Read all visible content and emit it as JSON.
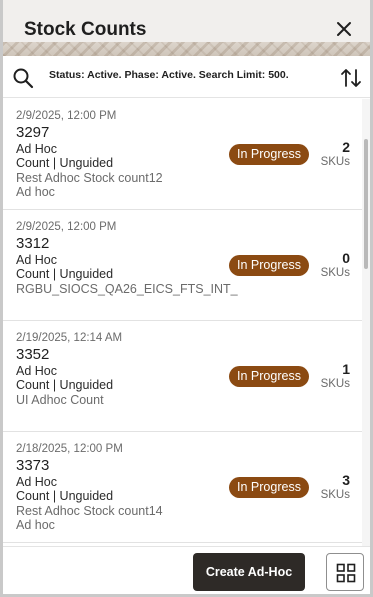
{
  "header": {
    "title": "Stock Counts",
    "close_icon": "close-icon"
  },
  "filter": {
    "search_icon": "search-icon",
    "summary": "Status: Active. Phase: Active. Search Limit: 500.",
    "sort_icon": "sort-icon"
  },
  "counts": [
    {
      "date": "2/9/2025, 12:00 PM",
      "id": "3297",
      "type": "Ad Hoc",
      "mode": "Count | Unguided",
      "description": "Rest Adhoc Stock count12",
      "subtype": "Ad hoc",
      "status": "In Progress",
      "sku_count": "2",
      "sku_label": "SKUs"
    },
    {
      "date": "2/9/2025, 12:00 PM",
      "id": "3312",
      "type": "Ad Hoc",
      "mode": "Count | Unguided",
      "description": "RGBU_SIOCS_QA26_EICS_FTS_INT_",
      "subtype": "",
      "status": "In Progress",
      "sku_count": "0",
      "sku_label": "SKUs"
    },
    {
      "date": "2/19/2025, 12:14 AM",
      "id": "3352",
      "type": "Ad Hoc",
      "mode": "Count | Unguided",
      "description": "UI Adhoc Count",
      "subtype": "",
      "status": "In Progress",
      "sku_count": "1",
      "sku_label": "SKUs"
    },
    {
      "date": "2/18/2025, 12:00 PM",
      "id": "3373",
      "type": "Ad Hoc",
      "mode": "Count | Unguided",
      "description": "Rest Adhoc Stock count14",
      "subtype": "Ad hoc",
      "status": "In Progress",
      "sku_count": "3",
      "sku_label": "SKUs"
    }
  ],
  "footer": {
    "create_label": "Create Ad-Hoc",
    "grid_icon": "grid-icon"
  },
  "colors": {
    "badge": "#8b4a12",
    "primary_button": "#2e2a27",
    "header_bg": "#f1efed"
  }
}
